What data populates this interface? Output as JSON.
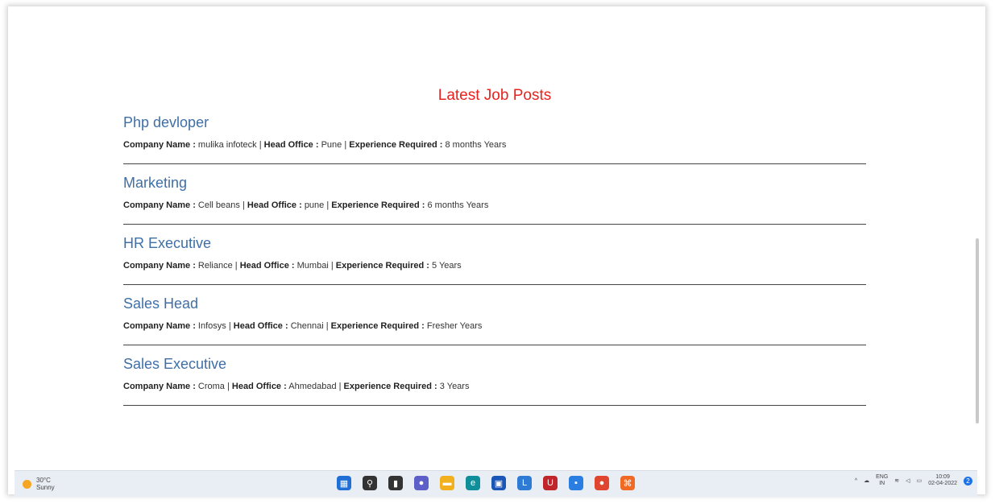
{
  "section_title": "Latest Job Posts",
  "labels": {
    "company": "Company Name :",
    "office": "Head Office :",
    "experience": "Experience Required :"
  },
  "jobs": [
    {
      "title": "Php devloper",
      "company": "mulika infoteck",
      "office": "Pune",
      "experience": "8 months Years"
    },
    {
      "title": "Marketing",
      "company": "Cell beans",
      "office": "pune",
      "experience": "6 months Years"
    },
    {
      "title": "HR Executive",
      "company": "Reliance",
      "office": "Mumbai",
      "experience": "5 Years"
    },
    {
      "title": "Sales Head",
      "company": "Infosys",
      "office": "Chennai",
      "experience": "Fresher Years"
    },
    {
      "title": "Sales Executive",
      "company": "Croma",
      "office": "Ahmedabad",
      "experience": "3 Years"
    }
  ],
  "taskbar": {
    "weather_temp": "30°C",
    "weather_desc": "Sunny",
    "lang_top": "ENG",
    "lang_bottom": "IN",
    "time": "10:09",
    "date": "02-04-2022",
    "apps": [
      {
        "icon": "windows-start-icon",
        "color": "#1f6fd6",
        "glyph": "▦"
      },
      {
        "icon": "search-icon",
        "color": "#333333",
        "glyph": "⚲"
      },
      {
        "icon": "task-view-icon",
        "color": "#333333",
        "glyph": "▮"
      },
      {
        "icon": "chat-icon",
        "color": "#5b5fc7",
        "glyph": "●"
      },
      {
        "icon": "file-explorer-icon",
        "color": "#f2b01e",
        "glyph": "▬"
      },
      {
        "icon": "edge-icon",
        "color": "#0f8f9a",
        "glyph": "e"
      },
      {
        "icon": "store-icon",
        "color": "#1a55b8",
        "glyph": "▣"
      },
      {
        "icon": "app-l-icon",
        "color": "#2e7bd6",
        "glyph": "L"
      },
      {
        "icon": "mcafee-icon",
        "color": "#c0252c",
        "glyph": "U"
      },
      {
        "icon": "app-blue-icon",
        "color": "#2a7de1",
        "glyph": "▪"
      },
      {
        "icon": "chrome-icon",
        "color": "#e0452f",
        "glyph": "●"
      },
      {
        "icon": "xampp-icon",
        "color": "#f06a25",
        "glyph": "⌘"
      }
    ]
  }
}
